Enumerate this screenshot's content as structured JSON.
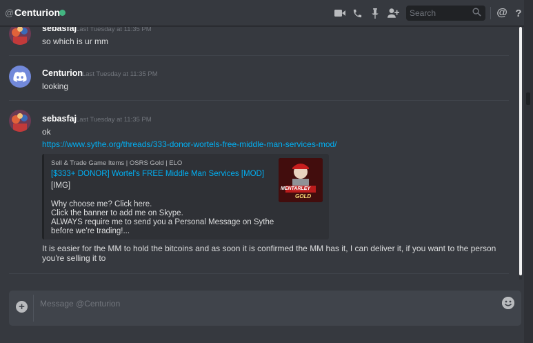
{
  "header": {
    "channel_prefix": "@",
    "channel_name": "Centurion",
    "status_color": "#43b581",
    "icons": [
      "video-call-icon",
      "voice-call-icon",
      "pin-icon",
      "add-friend-icon",
      "mention-icon",
      "help-icon"
    ],
    "search_placeholder": "Search"
  },
  "messages": [
    {
      "author": "sebasfaj",
      "timestamp": "Last Tuesday at 11:35 PM",
      "lines": [
        "so which is ur mm"
      ]
    },
    {
      "author": "Centurion",
      "timestamp": "Last Tuesday at 11:35 PM",
      "lines": [
        "looking"
      ]
    },
    {
      "author": "sebasfaj",
      "timestamp": "Last Tuesday at 11:35 PM",
      "lines": [
        "ok"
      ],
      "link": "https://www.sythe.org/threads/333-donor-wortels-free-middle-man-services-mod/",
      "embed": {
        "provider": "Sell & Trade Game Items | OSRS Gold | ELO",
        "title": "[$333+ DONOR] Wortel's FREE Middle Man Services [MOD]",
        "description": [
          "[IMG]",
          "",
          "Why choose me? Click here.",
          "Click the banner to add me on Skype.",
          "ALWAYS require me to send you a Personal Message on Sythe",
          "before we're trading!..."
        ],
        "thumbnail_text": [
          "MENTARLEY",
          "GOLD"
        ]
      },
      "after_lines": [
        "It is easier for the MM to hold the bitcoins and as soon it is confirmed the MM has it, I can deliver it, if you want to the person",
        "you're selling it to"
      ]
    }
  ],
  "composer": {
    "placeholder": "Message @Centurion"
  },
  "colors": {
    "background": "#36393f",
    "link": "#00b0f4",
    "composer": "#40444b"
  }
}
